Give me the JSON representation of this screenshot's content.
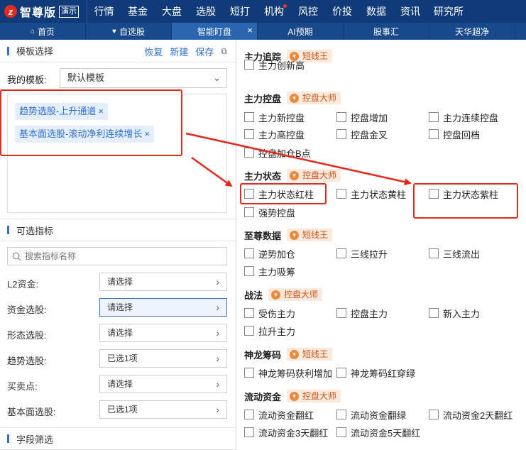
{
  "app": {
    "logo_mark": "z",
    "name": "智尊版",
    "version_badge": "演示"
  },
  "topnav": [
    "行情",
    "基金",
    "大盘",
    "选股",
    "短打",
    "机构",
    "风控",
    "价投",
    "数据",
    "资讯",
    "研究所"
  ],
  "tabs": [
    {
      "label": "首页",
      "icon": "home-icon",
      "active": false,
      "closable": false
    },
    {
      "label": "自选股",
      "icon": "heart-icon",
      "active": false,
      "closable": false
    },
    {
      "label": "智能盯盘",
      "icon": "",
      "active": true,
      "closable": true
    },
    {
      "label": "AI预期",
      "icon": "",
      "active": false,
      "closable": false
    },
    {
      "label": "股事汇",
      "icon": "",
      "active": false,
      "closable": false
    },
    {
      "label": "天华超净",
      "icon": "",
      "active": false,
      "closable": false
    }
  ],
  "left": {
    "template_section": {
      "title": "模板选择",
      "restore": "恢复",
      "new": "新建",
      "save": "保存"
    },
    "my_template": {
      "label": "我的模板:",
      "value": "默认模板"
    },
    "selected_tags": [
      "趋势选股-上升通道",
      "基本面选股-滚动净利连续增长"
    ],
    "indicator_section": {
      "title": "可选指标",
      "search_placeholder": "搜索指标名称"
    },
    "filters": [
      {
        "label": "L2资金:",
        "value": "请选择",
        "highlight": false
      },
      {
        "label": "资金选股:",
        "value": "请选择",
        "highlight": true
      },
      {
        "label": "形态选股:",
        "value": "请选择",
        "highlight": false
      },
      {
        "label": "趋势选股:",
        "value": "已选1项",
        "highlight": false
      },
      {
        "label": "买卖点:",
        "value": "请选择",
        "highlight": false
      },
      {
        "label": "基本面选股:",
        "value": "已选1项",
        "highlight": false
      }
    ],
    "field_section": {
      "title": "字段筛选"
    }
  },
  "groups": [
    {
      "name": "主力追踪",
      "badge": "短线王",
      "items": [
        "主力创新高"
      ]
    },
    {
      "name": "主力控盘",
      "badge": "控盘大师",
      "items": [
        "主力新控盘",
        "控盘增加",
        "主力连续控盘",
        "主力高控盘",
        "控盘金叉",
        "控盘回档",
        "控盘加仓B点"
      ]
    },
    {
      "name": "主力状态",
      "badge": "控盘大师",
      "items": [
        "主力状态红柱",
        "主力状态黄柱",
        "主力状态紫柱",
        "强势控盘"
      ]
    },
    {
      "name": "至尊数据",
      "badge": "短线王",
      "items": [
        "逆势加仓",
        "三线拉升",
        "三线流出",
        "主力吸筹"
      ]
    },
    {
      "name": "战法",
      "badge": "控盘大师",
      "items": [
        "受伤主力",
        "控盘主力",
        "新入主力",
        "拉升主力"
      ]
    },
    {
      "name": "神龙筹码",
      "badge": "短线王",
      "items": [
        "神龙筹码获利增加",
        "神龙筹码红穿绿"
      ]
    },
    {
      "name": "流动资金",
      "badge": "控盘大师",
      "items": [
        "流动资金翻红",
        "流动资金翻绿",
        "流动资金2天翻红",
        "流动资金3天翻红",
        "流动资金5天翻红"
      ]
    }
  ],
  "colors": {
    "nav_bg": "#103b78",
    "accent": "#2f6fcf",
    "annotation": "#e4281c",
    "badge_bg": "#fbe9dc"
  }
}
